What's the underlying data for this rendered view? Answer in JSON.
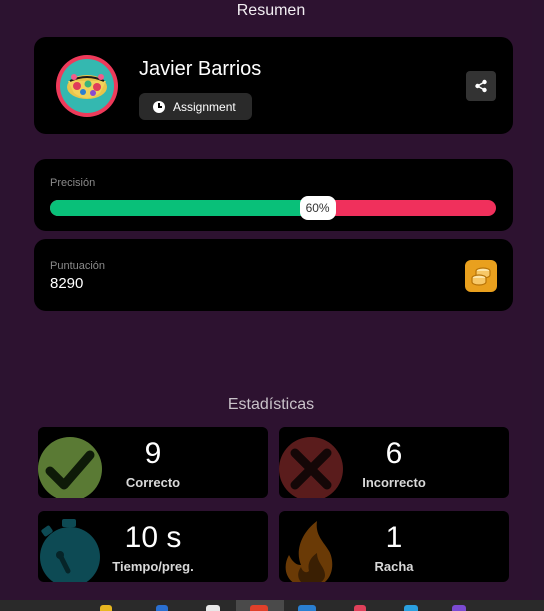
{
  "header": {
    "title": "Resumen"
  },
  "profile": {
    "name": "Javier Barrios",
    "badge_label": "Assignment",
    "avatar_icon": "player-avatar",
    "share_icon": "share-icon"
  },
  "accuracy": {
    "label": "Precisión",
    "value_text": "60%",
    "percent": 60,
    "correct_color": "#09c079",
    "incorrect_color": "#f0305c"
  },
  "score": {
    "label": "Puntuación",
    "value": "8290",
    "icon": "coins-icon"
  },
  "stats": {
    "title": "Estadísticas",
    "correct": {
      "value": "9",
      "label": "Correcto",
      "icon": "check-icon"
    },
    "incorrect": {
      "value": "6",
      "label": "Incorrecto",
      "icon": "cross-icon"
    },
    "time": {
      "value": "10 s",
      "label": "Tiempo/preg.",
      "icon": "stopwatch-icon"
    },
    "streak": {
      "value": "1",
      "label": "Racha",
      "icon": "fire-icon"
    }
  }
}
